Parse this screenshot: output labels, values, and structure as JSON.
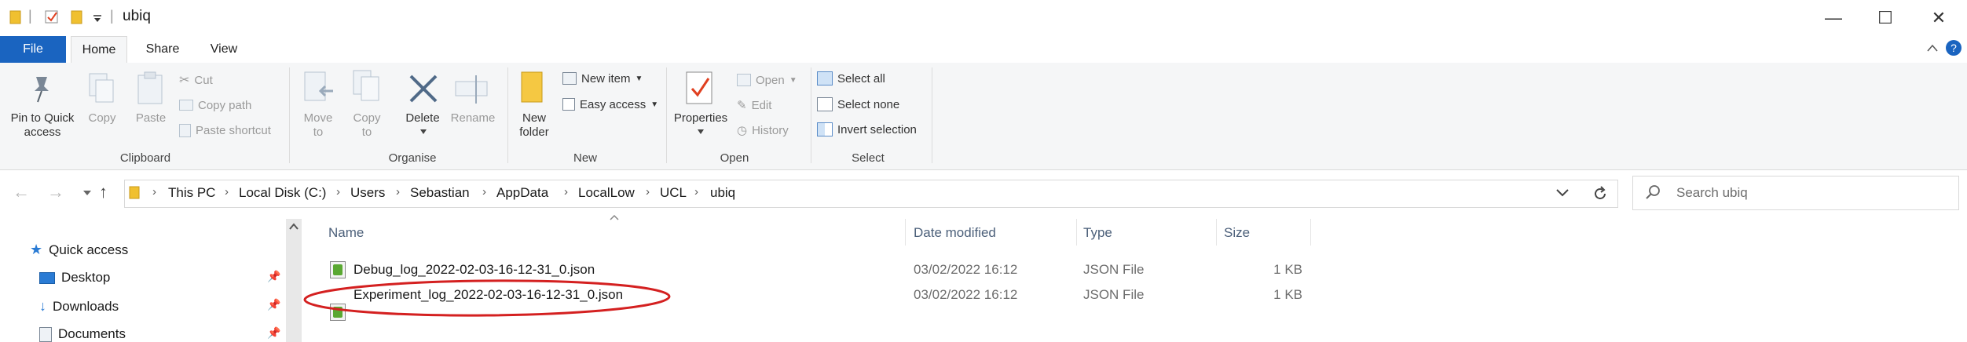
{
  "window": {
    "title": "ubiq",
    "minimize": "—",
    "maximize": "☐",
    "close": "✕"
  },
  "quick_toolbar": {
    "separator": "|"
  },
  "tabs": [
    {
      "label": "File"
    },
    {
      "label": "Home"
    },
    {
      "label": "Share"
    },
    {
      "label": "View"
    }
  ],
  "ribbon": {
    "clipboard": {
      "label": "Clipboard",
      "pin": "Pin to Quick\naccess",
      "copy": "Copy",
      "paste": "Paste",
      "cut": "Cut",
      "copy_path": "Copy path",
      "paste_shortcut": "Paste shortcut"
    },
    "organise": {
      "label": "Organise",
      "move_to": "Move\nto",
      "copy_to": "Copy\nto",
      "delete": "Delete",
      "rename": "Rename"
    },
    "new": {
      "label": "New",
      "new_folder": "New\nfolder",
      "new_item": "New item",
      "easy_access": "Easy access"
    },
    "open": {
      "label": "Open",
      "properties": "Properties",
      "open": "Open",
      "edit": "Edit",
      "history": "History"
    },
    "select": {
      "label": "Select",
      "select_all": "Select all",
      "select_none": "Select none",
      "invert_selection": "Invert selection"
    }
  },
  "address": {
    "crumbs": [
      "This PC",
      "Local Disk (C:)",
      "Users",
      "Sebastian",
      "AppData",
      "LocalLow",
      "UCL",
      "ubiq"
    ],
    "search_placeholder": "Search ubiq"
  },
  "nav": {
    "items": [
      {
        "label": "Quick access",
        "icon": "star-icon"
      },
      {
        "label": "Desktop",
        "icon": "desktop-icon"
      },
      {
        "label": "Downloads",
        "icon": "download-icon"
      },
      {
        "label": "Documents",
        "icon": "documents-icon"
      }
    ]
  },
  "columns": {
    "name": "Name",
    "date_modified": "Date modified",
    "type": "Type",
    "size": "Size"
  },
  "files": [
    {
      "name": "Debug_log_2022-02-03-16-12-31_0.json",
      "date": "03/02/2022 16:12",
      "type": "JSON File",
      "size": "1 KB"
    },
    {
      "name": "Experiment_log_2022-02-03-16-12-31_0.json",
      "date": "03/02/2022 16:12",
      "type": "JSON File",
      "size": "1 KB",
      "highlighted": true
    }
  ],
  "colors": {
    "file_tab": "#1a64c0",
    "annotation": "#d42020",
    "icon_folder": "#f0c030"
  }
}
